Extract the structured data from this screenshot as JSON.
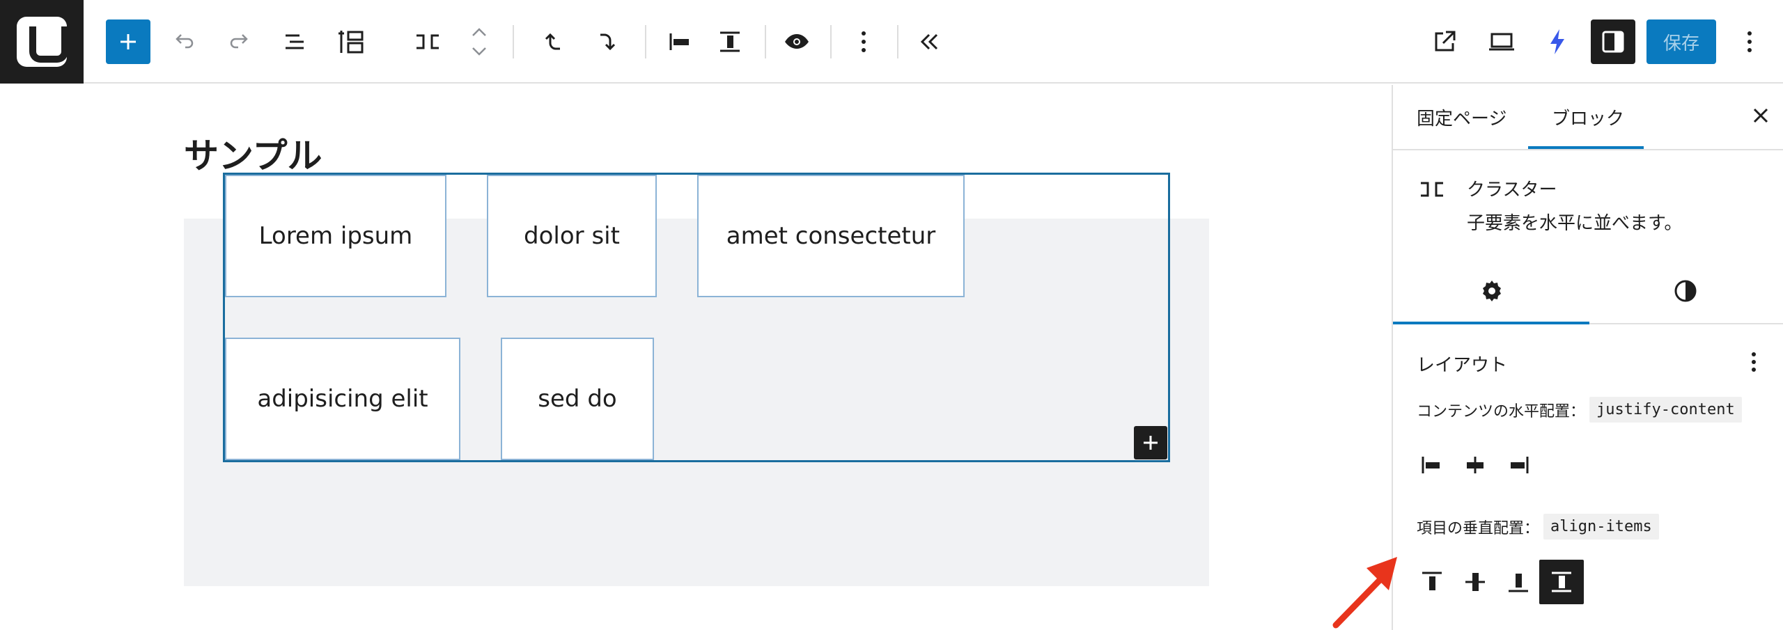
{
  "toolbar": {
    "save_label": "保存",
    "colors": {
      "accent": "#0a7abf",
      "dark": "#1e1e1e",
      "icon": "#1e1e1e",
      "muted": "#8c8f94",
      "jetpack": "#3858e9"
    }
  },
  "page": {
    "title": "サンプル",
    "cards": [
      {
        "label": "Lorem ipsum"
      },
      {
        "label": "dolor sit"
      },
      {
        "label": "amet consectetur"
      },
      {
        "label": "adipisicing elit"
      },
      {
        "label": "sed do"
      }
    ]
  },
  "sidebar": {
    "tabs": [
      {
        "label": "固定ページ",
        "active": false
      },
      {
        "label": "ブロック",
        "active": true
      }
    ],
    "block": {
      "name": "クラスター",
      "description": "子要素を水平に並べます。"
    },
    "panel": {
      "title": "レイアウト",
      "justify_label": "コンテンツの水平配置：",
      "justify_code": "justify-content",
      "align_label": "項目の垂直配置：",
      "align_code": "align-items"
    },
    "annotation_color": "#e8341c"
  }
}
